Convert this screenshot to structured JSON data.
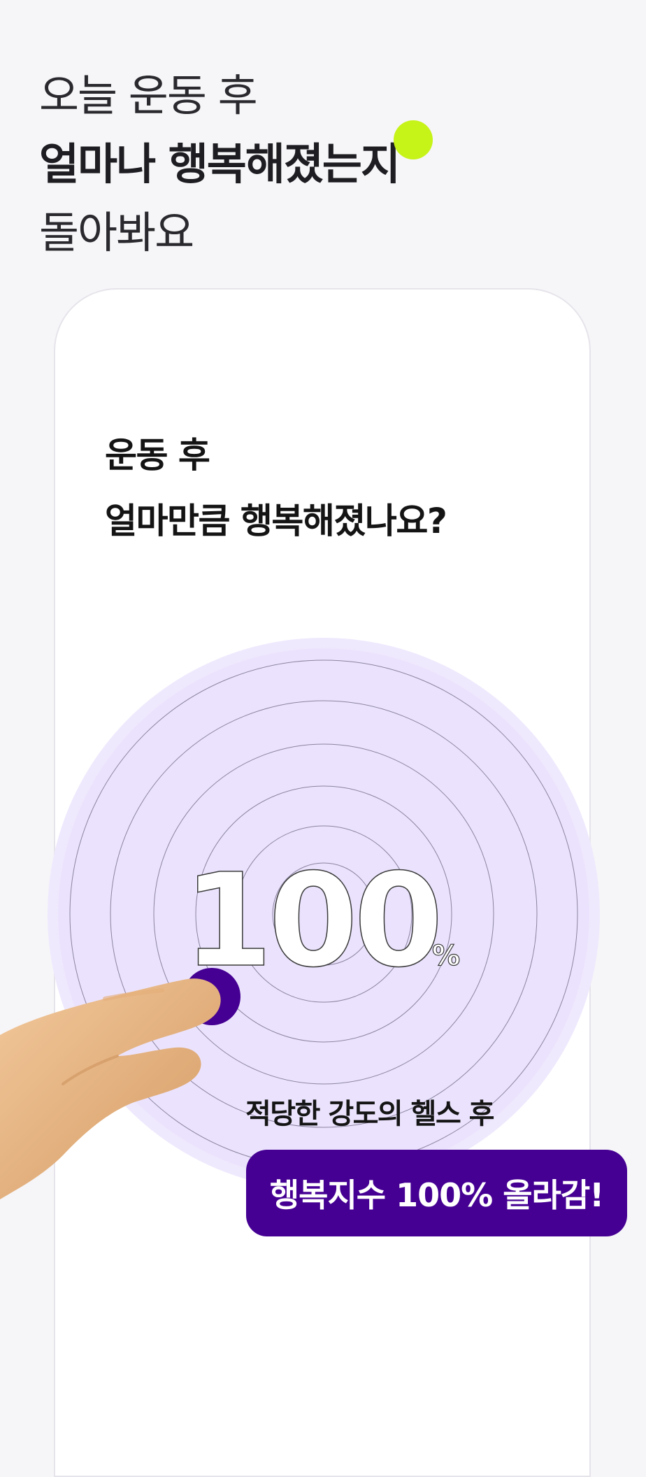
{
  "headline": {
    "line1": "오늘 운동 후",
    "line2": "얼마나 행복해졌는지",
    "line3": "돌아봐요"
  },
  "card": {
    "question_line1": "운동 후",
    "question_line2": "얼마만큼 행복해졌나요?",
    "happiness_value": "100",
    "happiness_unit": "%",
    "caption": "적당한 강도의 헬스 후",
    "badge": "행복지수 100% 올라감!"
  },
  "colors": {
    "background": "#f6f5f8",
    "accent_lime": "#c6f318",
    "brand_purple": "#450093",
    "ring_fill": "#ebe3fd",
    "ring_outer": "#efe9fd"
  },
  "icons": {
    "hand": "pointing-hand-icon",
    "knob": "slider-knob"
  }
}
